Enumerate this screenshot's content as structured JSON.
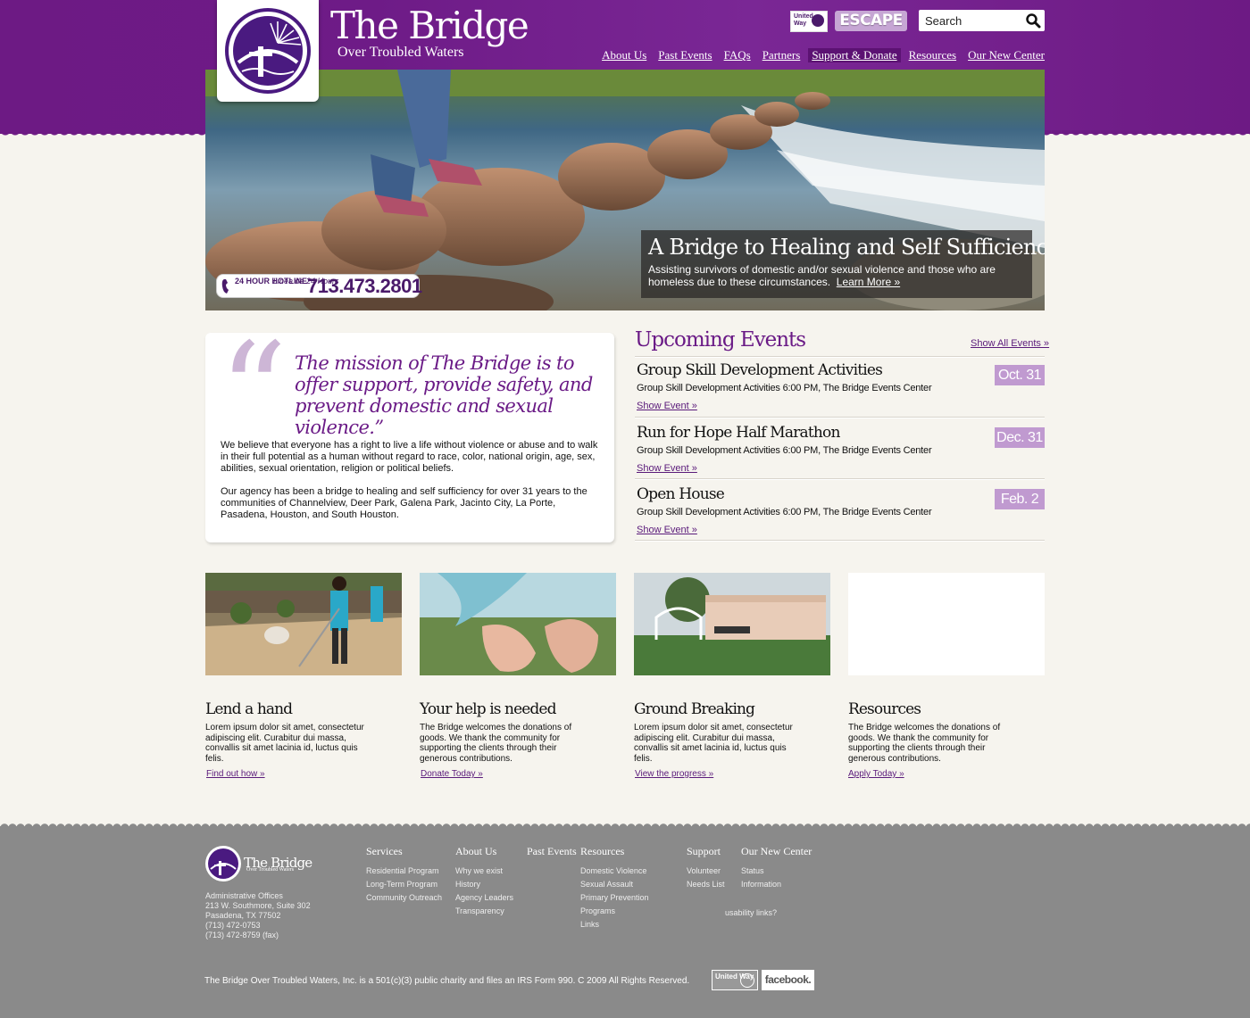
{
  "header": {
    "brand_title": "The Bridge",
    "brand_subtitle": "Over Troubled Waters",
    "united_way": "United Way",
    "escape_label": "ESCAPE",
    "search_placeholder": "Search",
    "nav": [
      "About Us",
      "Past Events",
      "FAQs",
      "Partners",
      "Support & Donate",
      "Resources",
      "Our New Center"
    ],
    "active_nav": "Support & Donate"
  },
  "hero": {
    "title": "A Bridge to Healing and Self Sufficiency",
    "text": "Assisting survivors of domestic and/or sexual violence and those who are homeless due to these circumstances.",
    "link": "Learn More »",
    "hotline_label_en": "24 HOUR HOTLINE",
    "hotline_label_es": "Linea de 24 Hours",
    "hotline_number": "713.473.2801"
  },
  "mission": {
    "quote": "The mission of The Bridge is to offer support, provide safety, and prevent domestic and sexual violence.”",
    "p1": "We believe that everyone has a right to live a life without violence or abuse and to walk in their full potential as a human without regard to race, color, national origin, age, sex, abilities, sexual orientation, religion or political beliefs.",
    "p2": "Our agency has been a bridge to healing and self sufficiency for over 31 years to the communities of Channelview, Deer Park, Galena Park, Jacinto City, La Porte, Pasadena, Houston, and South Houston."
  },
  "events": {
    "heading": "Upcoming Events",
    "show_all": "Show All Events »",
    "items": [
      {
        "title": "Group Skill Development Activities",
        "desc": "Group Skill Development Activities 6:00 PM, The Bridge Events Center",
        "link": "Show Event »",
        "date": "Oct. 31"
      },
      {
        "title": "Run for Hope Half Marathon",
        "desc": "Group Skill Development Activities 6:00 PM, The Bridge Events Center",
        "link": "Show Event »",
        "date": "Dec. 31"
      },
      {
        "title": "Open House",
        "desc": "Group Skill Development Activities 6:00 PM, The Bridge Events Center",
        "link": "Show Event »",
        "date": "Feb. 2"
      }
    ]
  },
  "promos": [
    {
      "title": "Lend a hand",
      "text": "Lorem ipsum dolor sit amet, consectetur adipiscing elit. Curabitur dui massa, convallis sit amet lacinia id, luctus quis felis.",
      "link": "Find out how »"
    },
    {
      "title": "Your help is needed",
      "text": "The Bridge welcomes the donations of goods. We thank the community for supporting the clients through their generous contributions.",
      "link": "Donate Today »"
    },
    {
      "title": "Ground Breaking",
      "text": "Lorem ipsum dolor sit amet, consectetur adipiscing elit. Curabitur dui massa, convallis sit amet lacinia id, luctus quis felis.",
      "link": "View the progress »"
    },
    {
      "title": "Resources",
      "text": "The Bridge welcomes the donations of goods. We thank the community for supporting the clients through their generous contributions.",
      "link": "Apply Today »"
    }
  ],
  "footer": {
    "brand": "The Bridge",
    "brand_sub": "Over Troubled Waters",
    "address": [
      "Administrative Offices",
      "213 W. Southmore, Suite 302",
      "Pasadena, TX 77502",
      "(713) 472-0753",
      "(713) 472-8759 (fax)"
    ],
    "columns": [
      {
        "head": "Services",
        "items": [
          "Residential Program",
          "Long-Term Program",
          "Community Outreach"
        ]
      },
      {
        "head": "About Us",
        "items": [
          "Why we exist",
          "History",
          "Agency Leaders",
          "Transparency"
        ]
      },
      {
        "head": "Past Events",
        "items": []
      },
      {
        "head": "Resources",
        "items": [
          "Domestic Violence",
          "Sexual Assault",
          "Primary Prevention",
          "Programs",
          "Links"
        ]
      },
      {
        "head": "Support",
        "items": [
          "Volunteer",
          "Needs List"
        ]
      },
      {
        "head": "Our New Center",
        "items": [
          "Status",
          "Information"
        ]
      }
    ],
    "usability": "usability links?",
    "legal": "The Bridge Over Troubled Waters, Inc. is a 501(c)(3) public charity and files an IRS Form 990.  C 2009  All Rights Reserved.",
    "united_way": "United Way",
    "facebook": "facebook."
  },
  "colors": {
    "brand_purple": "#6d1a84",
    "date_badge": "#c09ad0",
    "footer_gray": "#8a8a8a"
  }
}
